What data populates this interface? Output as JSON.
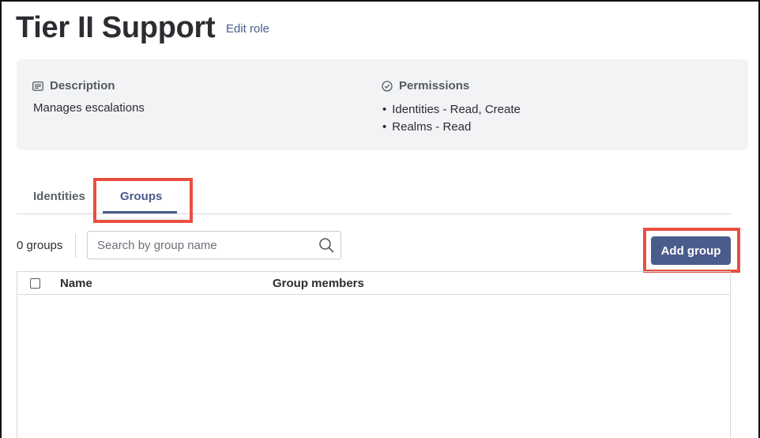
{
  "header": {
    "title": "Tier II Support",
    "edit_label": "Edit role"
  },
  "info": {
    "description_heading": "Description",
    "description_text": "Manages escalations",
    "permissions_heading": "Permissions",
    "permissions": [
      "Identities - Read, Create",
      "Realms - Read"
    ]
  },
  "tabs": [
    {
      "label": "Identities",
      "active": false
    },
    {
      "label": "Groups",
      "active": true
    }
  ],
  "toolbar": {
    "count_label": "0 groups",
    "search_placeholder": "Search by group name",
    "add_button_label": "Add group"
  },
  "table": {
    "columns": [
      "Name",
      "Group members"
    ],
    "rows": []
  },
  "colors": {
    "accent": "#4a5c8c",
    "highlight": "#e94f3f",
    "panel_bg": "#f2f3f5"
  },
  "icons": {
    "description": "document-lines-icon",
    "permissions": "check-circle-icon",
    "search": "search-icon"
  }
}
